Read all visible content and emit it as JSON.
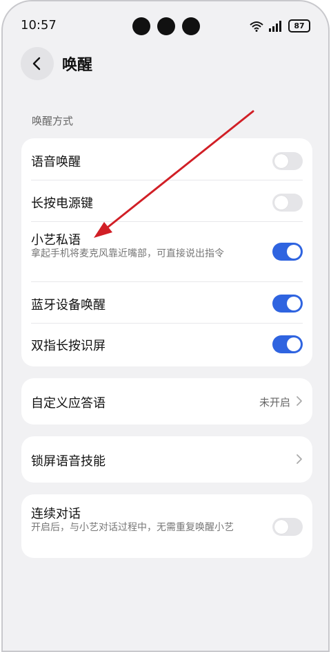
{
  "status": {
    "time": "10:57",
    "battery": "87"
  },
  "header": {
    "title": "唤醒"
  },
  "section": {
    "label": "唤醒方式"
  },
  "wake_methods": [
    {
      "title": "语音唤醒",
      "subtitle": "",
      "on": false
    },
    {
      "title": "长按电源键",
      "subtitle": "",
      "on": false
    },
    {
      "title": "小艺私语",
      "subtitle": "拿起手机将麦克风靠近嘴部，可直接说出指令",
      "on": true
    },
    {
      "title": "蓝牙设备唤醒",
      "subtitle": "",
      "on": true
    },
    {
      "title": "双指长按识屏",
      "subtitle": "",
      "on": true
    }
  ],
  "custom_reply": {
    "title": "自定义应答语",
    "value": "未开启"
  },
  "lock_voice": {
    "title": "锁屏语音技能"
  },
  "continuous": {
    "title": "连续对话",
    "subtitle": "开启后，与小艺对话过程中，无需重复唤醒小艺",
    "on": false
  },
  "colors": {
    "accent": "#2f64e0",
    "annotation_arrow": "#d11f26"
  }
}
